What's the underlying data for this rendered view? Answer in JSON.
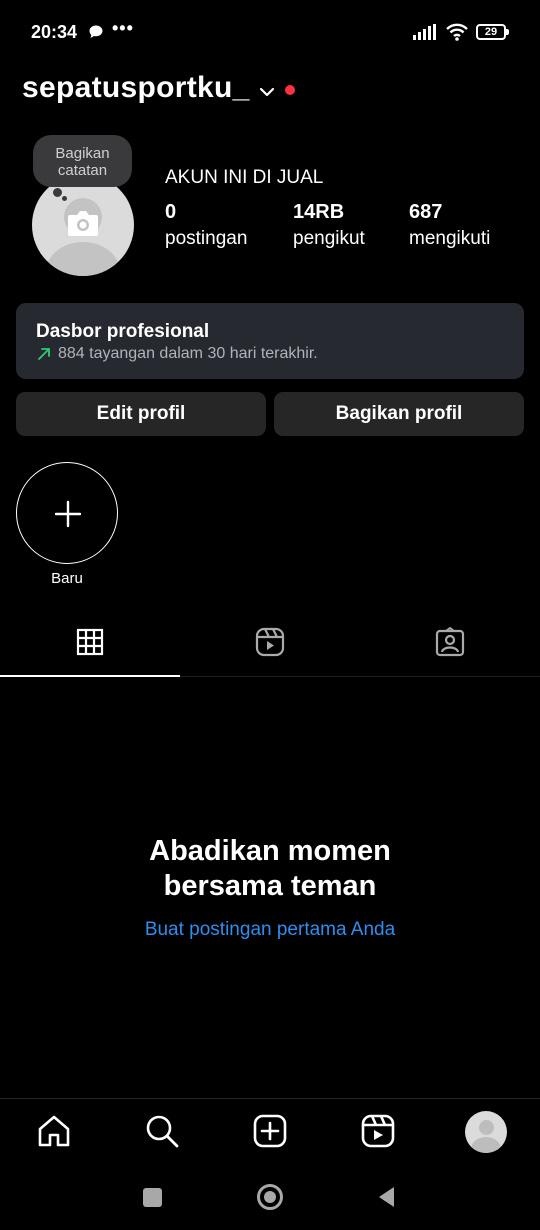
{
  "status_bar": {
    "time": "20:34",
    "more": "•••",
    "battery": "29",
    "icons": [
      "chat-bubble-icon",
      "signal-icon",
      "wifi-icon",
      "battery-icon"
    ]
  },
  "header": {
    "username": "sepatusportku_",
    "icons": [
      "chevron-down-icon",
      "notification-dot"
    ]
  },
  "note": {
    "text_line1": "Bagikan",
    "text_line2": "catatan"
  },
  "profile": {
    "bio": "AKUN INI DI JUAL",
    "stats": [
      {
        "count": "0",
        "label": "postingan"
      },
      {
        "count": "14RB",
        "label": "pengikut"
      },
      {
        "count": "687",
        "label": "mengikuti"
      }
    ]
  },
  "dashboard": {
    "title": "Dasbor profesional",
    "subtitle": "884 tayangan dalam 30 hari terakhir.",
    "arrow_color": "#2ecc71"
  },
  "buttons": {
    "edit_profile": "Edit profil",
    "share_profile": "Bagikan profil"
  },
  "highlights": {
    "new_label": "Baru"
  },
  "tabs": [
    "grid-icon",
    "reels-icon",
    "tagged-icon"
  ],
  "empty_state": {
    "title_line1": "Abadikan momen",
    "title_line2": "bersama teman",
    "link": "Buat postingan pertama Anda",
    "link_color": "#2d8ef0"
  },
  "bottom_nav": [
    "home-icon",
    "search-icon",
    "create-icon",
    "reels-icon",
    "profile-avatar"
  ],
  "system_nav": [
    "recents-button",
    "home-button",
    "back-button"
  ]
}
